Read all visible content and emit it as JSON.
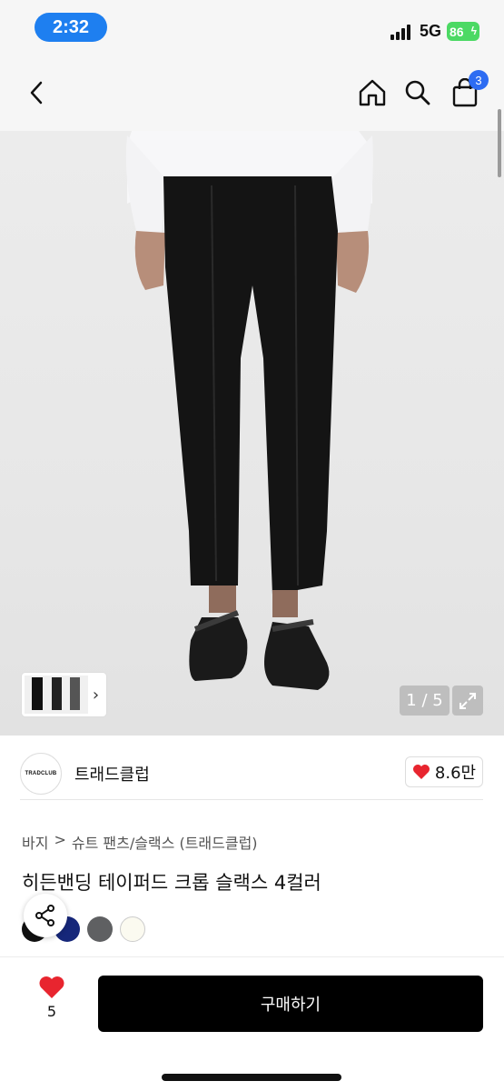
{
  "status_bar": {
    "time": "2:32",
    "network": "5G",
    "battery": "86"
  },
  "header": {
    "cart_count": "3"
  },
  "gallery": {
    "counter": "1 / 5"
  },
  "brand": {
    "logo_text": "TRADCLUB",
    "name": "트래드클럽",
    "likes": "8.6만"
  },
  "breadcrumb": {
    "items": [
      "바지",
      "슈트 팬츠/슬랙스 (트래드클럽)"
    ],
    "separator": ">"
  },
  "product": {
    "title": "히든밴딩 테이퍼드 크롭 슬랙스 4컬러",
    "colors": [
      "#111111",
      "#16277a",
      "#5f6062",
      "#fbfaf0"
    ]
  },
  "bottom_bar": {
    "wish_count": "5",
    "buy_label": "구매하기"
  },
  "theme": {
    "accent": "#2d6cf2",
    "heart": "#e8252f",
    "time_pill": "#1e7ff0",
    "battery": "#4cd964"
  }
}
